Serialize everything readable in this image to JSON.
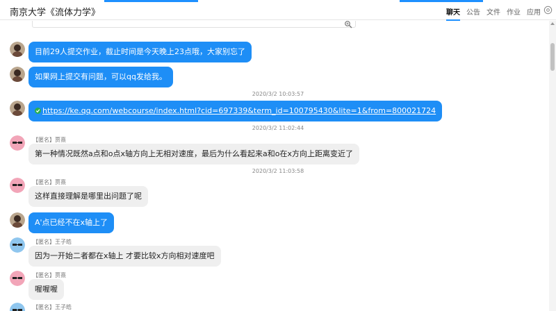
{
  "header": {
    "title": "南京大学《流体力学》",
    "tabs": [
      {
        "label": "聊天",
        "active": true
      },
      {
        "label": "公告",
        "active": false
      },
      {
        "label": "文件",
        "active": false
      },
      {
        "label": "作业",
        "active": false
      },
      {
        "label": "应用",
        "active": false
      }
    ],
    "settings_icon": "settings-icon"
  },
  "colors": {
    "accent": "#1e90ff",
    "bubble_self": "#1e8ef6",
    "bubble_other": "#efefef"
  },
  "messages": [
    {
      "avatar": "teacher-avatar",
      "text": "目前29人提交作业，截止时间是今天晚上23点哦，大家别忘了"
    },
    {
      "avatar": "teacher-avatar",
      "text": "如果网上提交有问题，可以qq发给我。"
    },
    {
      "timestamp": "2020/3/2 10:03:57"
    },
    {
      "avatar": "teacher-avatar",
      "icon": "check-icon",
      "link": "https://ke.qq.com/webcourse/index.html?cid=697339&term_id=100795430&lite=1&from=800021724"
    },
    {
      "timestamp": "2020/3/2 11:02:44"
    },
    {
      "sender": "【匿名】贾熹",
      "avatar": "student-avatar-pink",
      "text": "第一种情况既然a点和o点x轴方向上无相对速度，最后为什么看起来a和o在x方向上距离变近了"
    },
    {
      "timestamp": "2020/3/2 11:03:58"
    },
    {
      "sender": "【匿名】贾熹",
      "avatar": "student-avatar-pink",
      "text": "这样直接理解是哪里出问题了呢"
    },
    {
      "avatar": "teacher-avatar",
      "text": "A'点已经不在x轴上了"
    },
    {
      "sender": "【匿名】王子皓",
      "avatar": "student-avatar-blue",
      "text": "因为一开始二者都在x轴上 才要比较x方向相对速度吧"
    },
    {
      "sender": "【匿名】贾熹",
      "avatar": "student-avatar-pink",
      "text": "喔喔喔"
    },
    {
      "sender": "【匿名】王子皓",
      "avatar": "student-avatar-blue"
    }
  ]
}
